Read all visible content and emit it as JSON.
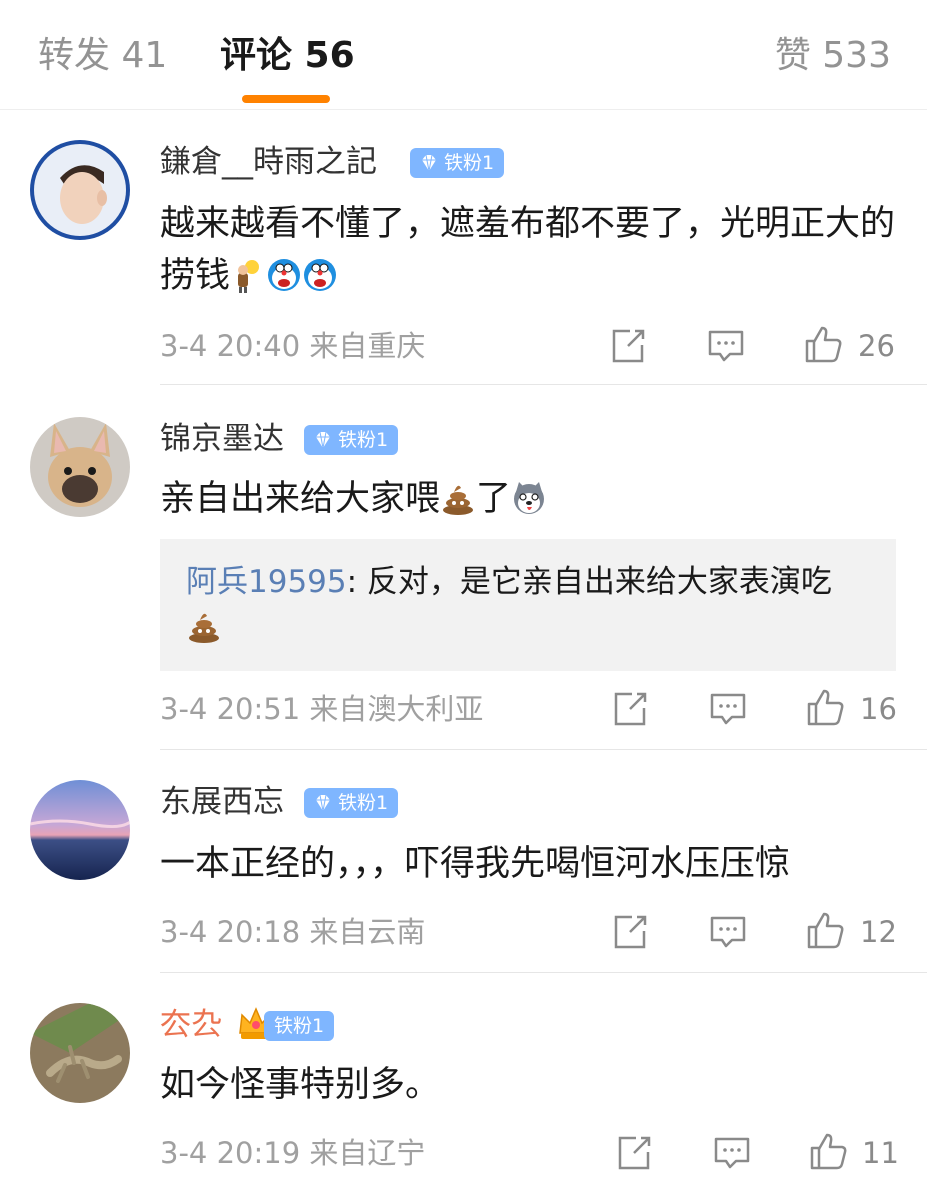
{
  "tabs": {
    "repost": "转发 41",
    "comments": "评论 56",
    "likes": "赞 533"
  },
  "colors": {
    "accent": "#ff8200",
    "badge": "#7fb6ff",
    "reply_user": "#5a7fb5",
    "vip_name": "#eb7350"
  },
  "comments": [
    {
      "username": "鎌倉__時雨之記",
      "badge": "铁粉1",
      "text": "越来越看不懂了，遮羞布都不要了，光明正大的捞钱",
      "emojis": [
        "idea-emoji",
        "doraemon-emoji",
        "doraemon-emoji"
      ],
      "time": "3-4 20:40",
      "source": "来自重庆",
      "likes": "26"
    },
    {
      "username": "锦京墨达",
      "badge": "铁粉1",
      "text": "亲自出来给大家喂",
      "text_after": "了",
      "emojis": [
        "poop-emoji",
        "husky-emoji"
      ],
      "reply": {
        "user": "阿兵19595",
        "text": ": 反对，是它亲自出来给大家表演吃"
      },
      "time": "3-4 20:51",
      "source": "来自澳大利亚",
      "likes": "16"
    },
    {
      "username": "东展西忘",
      "badge": "铁粉1",
      "text": "一本正经的，，，吓得我先喝恒河水压压惊",
      "time": "3-4 20:18",
      "source": "来自云南",
      "likes": "12"
    },
    {
      "username": "厺厹",
      "badge": "铁粉1",
      "text": "如今怪事特别多。",
      "time": "3-4 20:19",
      "source": "来自辽宁",
      "likes": "11"
    }
  ]
}
